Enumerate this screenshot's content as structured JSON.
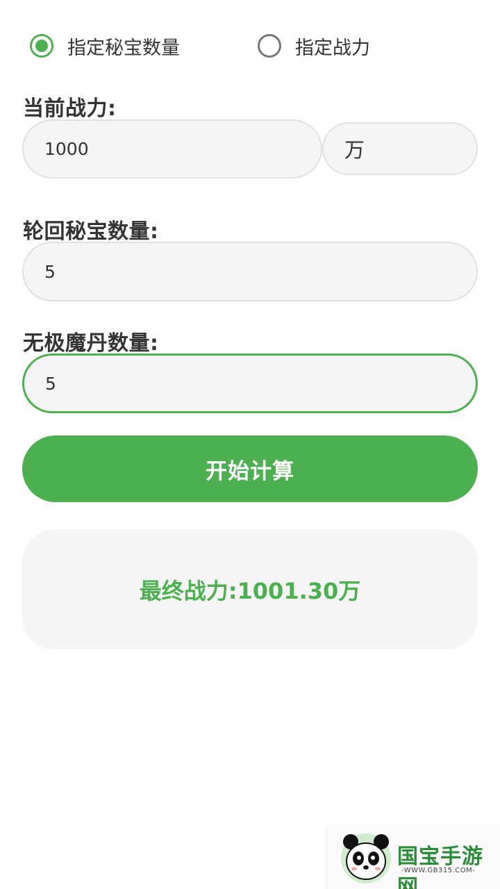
{
  "mode": {
    "options": [
      {
        "label": "指定秘宝数量",
        "checked": true
      },
      {
        "label": "指定战力",
        "checked": false
      }
    ]
  },
  "current_power": {
    "label": "当前战力:",
    "value": "1000",
    "unit": "万"
  },
  "treasure": {
    "label": "轮回秘宝数量:",
    "value": "5"
  },
  "pill": {
    "label": "无极魔丹数量:",
    "value": "5"
  },
  "calculate_button": "开始计算",
  "result": {
    "text": "最终战力:1001.30万"
  },
  "watermark": {
    "brand": "国宝手游网",
    "url": "-WWW.GB315.COM-"
  },
  "colors": {
    "accent": "#4caf50",
    "field_bg": "#f5f5f5",
    "text": "#333333"
  }
}
